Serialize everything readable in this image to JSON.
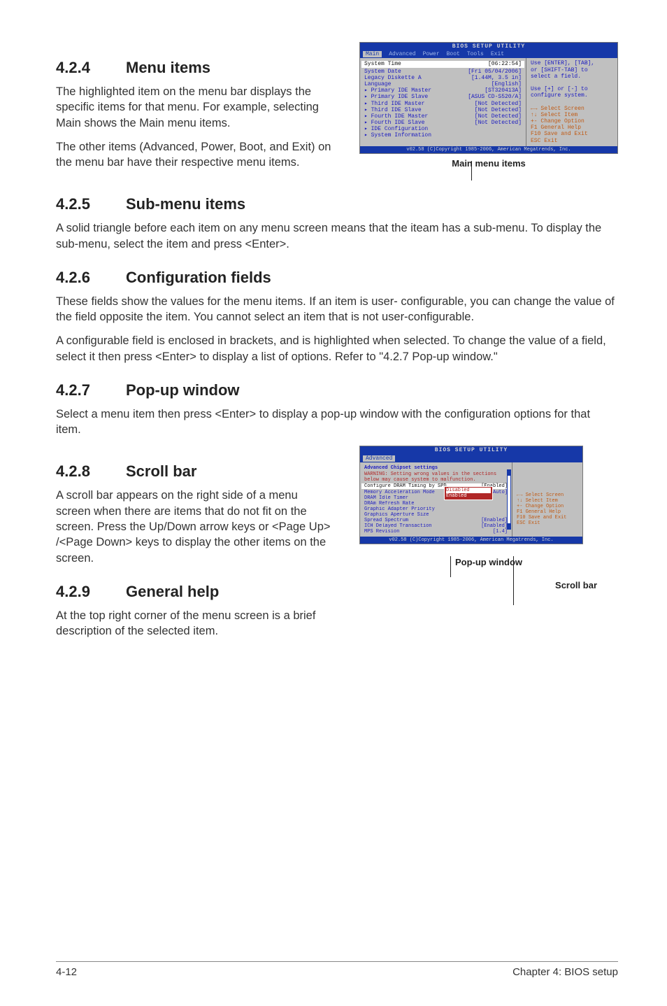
{
  "sections": {
    "s424": {
      "num": "4.2.4",
      "title": "Menu items",
      "p1": "The highlighted item on the menu bar displays the specific items for that menu. For example, selecting Main shows the Main menu items.",
      "p2": "The other items (Advanced, Power, Boot, and Exit) on the menu bar have their respective menu items."
    },
    "s425": {
      "num": "4.2.5",
      "title": "Sub-menu items",
      "p1": "A solid triangle before each item on any menu screen means that the iteam has a sub-menu. To display the sub-menu, select the item and press <Enter>."
    },
    "s426": {
      "num": "4.2.6",
      "title": "Configuration fields",
      "p1": "These fields show the values for the menu items. If an item is user- configurable, you can change the value of the field opposite the item. You cannot select an item that is not user-configurable.",
      "p2": "A configurable field is enclosed in brackets, and is highlighted when selected. To change the value of a field, select it then press <Enter> to display a list of options. Refer to \"4.2.7 Pop-up window.\""
    },
    "s427": {
      "num": "4.2.7",
      "title": "Pop-up window",
      "p1": "Select a menu item then press <Enter> to display a pop-up window with the configuration options for that item."
    },
    "s428": {
      "num": "4.2.8",
      "title": "Scroll bar",
      "p1": "A scroll bar appears on the right side of a menu screen when there are items that do not fit on the screen. Press the Up/Down arrow keys or <Page Up> /<Page Down> keys to display the other items on the screen."
    },
    "s429": {
      "num": "4.2.9",
      "title": "General help",
      "p1": "At the top right corner of the menu screen is a brief description of the selected item."
    }
  },
  "bios1": {
    "title": "BIOS SETUP UTILITY",
    "menubar": [
      "Main",
      "Advanced",
      "Power",
      "Boot",
      "Tools",
      "Exit"
    ],
    "selected_tab": "Main",
    "left": [
      {
        "k": "System Time",
        "v": "[06:22:54]"
      },
      {
        "k": "System Date",
        "v": "[Fri 05/04/2006]"
      },
      {
        "k": "Legacy Diskette A",
        "v": "[1.44M, 3.5 in]"
      },
      {
        "k": "Language",
        "v": "[English]"
      },
      {
        "k": "",
        "v": ""
      },
      {
        "k": "▸ Primary IDE Master",
        "v": "[ST320413A]"
      },
      {
        "k": "▸ Primary IDE Slave",
        "v": "[ASUS CD-S520/A]"
      },
      {
        "k": "▸ Third IDE Master",
        "v": "[Not Detected]"
      },
      {
        "k": "▸ Third IDE Slave",
        "v": "[Not Detected]"
      },
      {
        "k": "▸ Fourth IDE Master",
        "v": "[Not Detected]"
      },
      {
        "k": "▸ Fourth IDE Slave",
        "v": "[Not Detected]"
      },
      {
        "k": "▸ IDE Configuration",
        "v": ""
      },
      {
        "k": "",
        "v": ""
      },
      {
        "k": "▸ System Information",
        "v": ""
      }
    ],
    "right_help": {
      "l1": "Use [ENTER], [TAB],",
      "l2": "or [SHIFT-TAB] to",
      "l3": "select a field.",
      "l4": "",
      "l5": "Use [+] or [-] to",
      "l6": "configure system.",
      "nav": [
        {
          "k": "←→",
          "v": "Select Screen"
        },
        {
          "k": "↑↓",
          "v": "Select Item"
        },
        {
          "k": "+-",
          "v": "Change Option"
        },
        {
          "k": "F1",
          "v": "General Help"
        },
        {
          "k": "F10",
          "v": "Save and Exit"
        },
        {
          "k": "ESC",
          "v": "Exit"
        }
      ]
    },
    "footer": "v02.58 (C)Copyright 1985-2006, American Megatrends, Inc.",
    "caption": "Main menu items"
  },
  "bios2": {
    "title": "BIOS SETUP UTILITY",
    "menubar_sel": "Advanced",
    "heading": "Advanced Chipset settings",
    "warning": "WARNING: Setting wrong values in the sections below may cause system to malfunction.",
    "left": [
      {
        "k": "Configure DRAM Timing by SPD",
        "v": "[Enabled]"
      },
      {
        "k": "Memory Acceleration Mode",
        "v": "[Auto]"
      },
      {
        "k": "DRAM Idle Timer",
        "v": ""
      },
      {
        "k": "DRAm Refresh Rate",
        "v": ""
      },
      {
        "k": "",
        "v": ""
      },
      {
        "k": "Graphic Adapter Priority",
        "v": ""
      },
      {
        "k": "Graphics Aperture Size",
        "v": ""
      },
      {
        "k": "Spread Spectrum",
        "v": "[Enabled]"
      },
      {
        "k": "",
        "v": ""
      },
      {
        "k": "ICH Delayed Transaction",
        "v": "[Enabled]"
      },
      {
        "k": "",
        "v": ""
      },
      {
        "k": "MPS Revision",
        "v": "[1.4]"
      }
    ],
    "popup_options": [
      "Disabled",
      "Enabled"
    ],
    "right_nav": [
      {
        "k": "←→",
        "v": "Select Screen"
      },
      {
        "k": "↑↓",
        "v": "Select Item"
      },
      {
        "k": "+-",
        "v": "Change Option"
      },
      {
        "k": "F1",
        "v": "General Help"
      },
      {
        "k": "F10",
        "v": "Save and Exit"
      },
      {
        "k": "ESC",
        "v": "Exit"
      }
    ],
    "footer": "v02.58 (C)Copyright 1985-2006, American Megatrends, Inc.",
    "caption1": "Pop-up window",
    "caption2": "Scroll bar"
  },
  "footer": {
    "left": "4-12",
    "right": "Chapter 4: BIOS setup"
  }
}
